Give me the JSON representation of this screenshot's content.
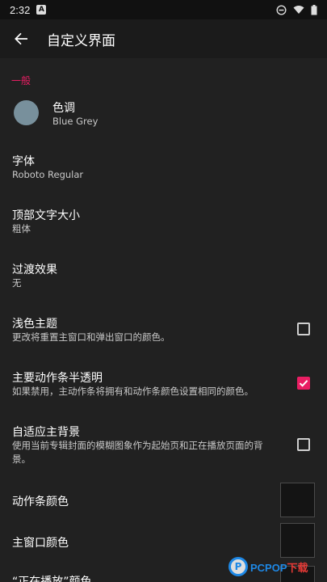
{
  "status_bar": {
    "time": "2:32",
    "app_indicator": "A",
    "icons": [
      "dnd-icon",
      "wifi-icon",
      "battery-icon"
    ]
  },
  "app_bar": {
    "title": "自定义界面",
    "back_icon": "arrow-back-icon"
  },
  "section": {
    "title": "一般"
  },
  "prefs": {
    "tone": {
      "title": "色调",
      "summary": "Blue Grey",
      "color": "#78909c"
    },
    "font": {
      "title": "字体",
      "summary": "Roboto Regular"
    },
    "top_text_size": {
      "title": "顶部文字大小",
      "summary": "粗体"
    },
    "transition": {
      "title": "过渡效果",
      "summary": "无"
    },
    "light_theme": {
      "title": "浅色主题",
      "summary": "更改将重置主窗口和弹出窗口的颜色。",
      "checked": false
    },
    "translucent_actionbar": {
      "title": "主要动作条半透明",
      "summary": "如果禁用，主动作条将拥有和动作条颜色设置相同的颜色。",
      "checked": true
    },
    "adaptive_background": {
      "title": "自适应主背景",
      "summary": "使用当前专辑封面的模糊图象作为起始页和正在播放页面的背景。",
      "checked": false
    },
    "actionbar_color": {
      "title": "动作条颜色"
    },
    "main_window_color": {
      "title": "主窗口颜色"
    },
    "now_playing_color": {
      "title": "“正在播放”颜色"
    }
  },
  "watermark": {
    "logo": "P",
    "text_a": "PCPOP",
    "text_b": "下载"
  },
  "colors": {
    "accent": "#e91e63",
    "background": "#212121",
    "toolbar": "#1b1b1b"
  }
}
